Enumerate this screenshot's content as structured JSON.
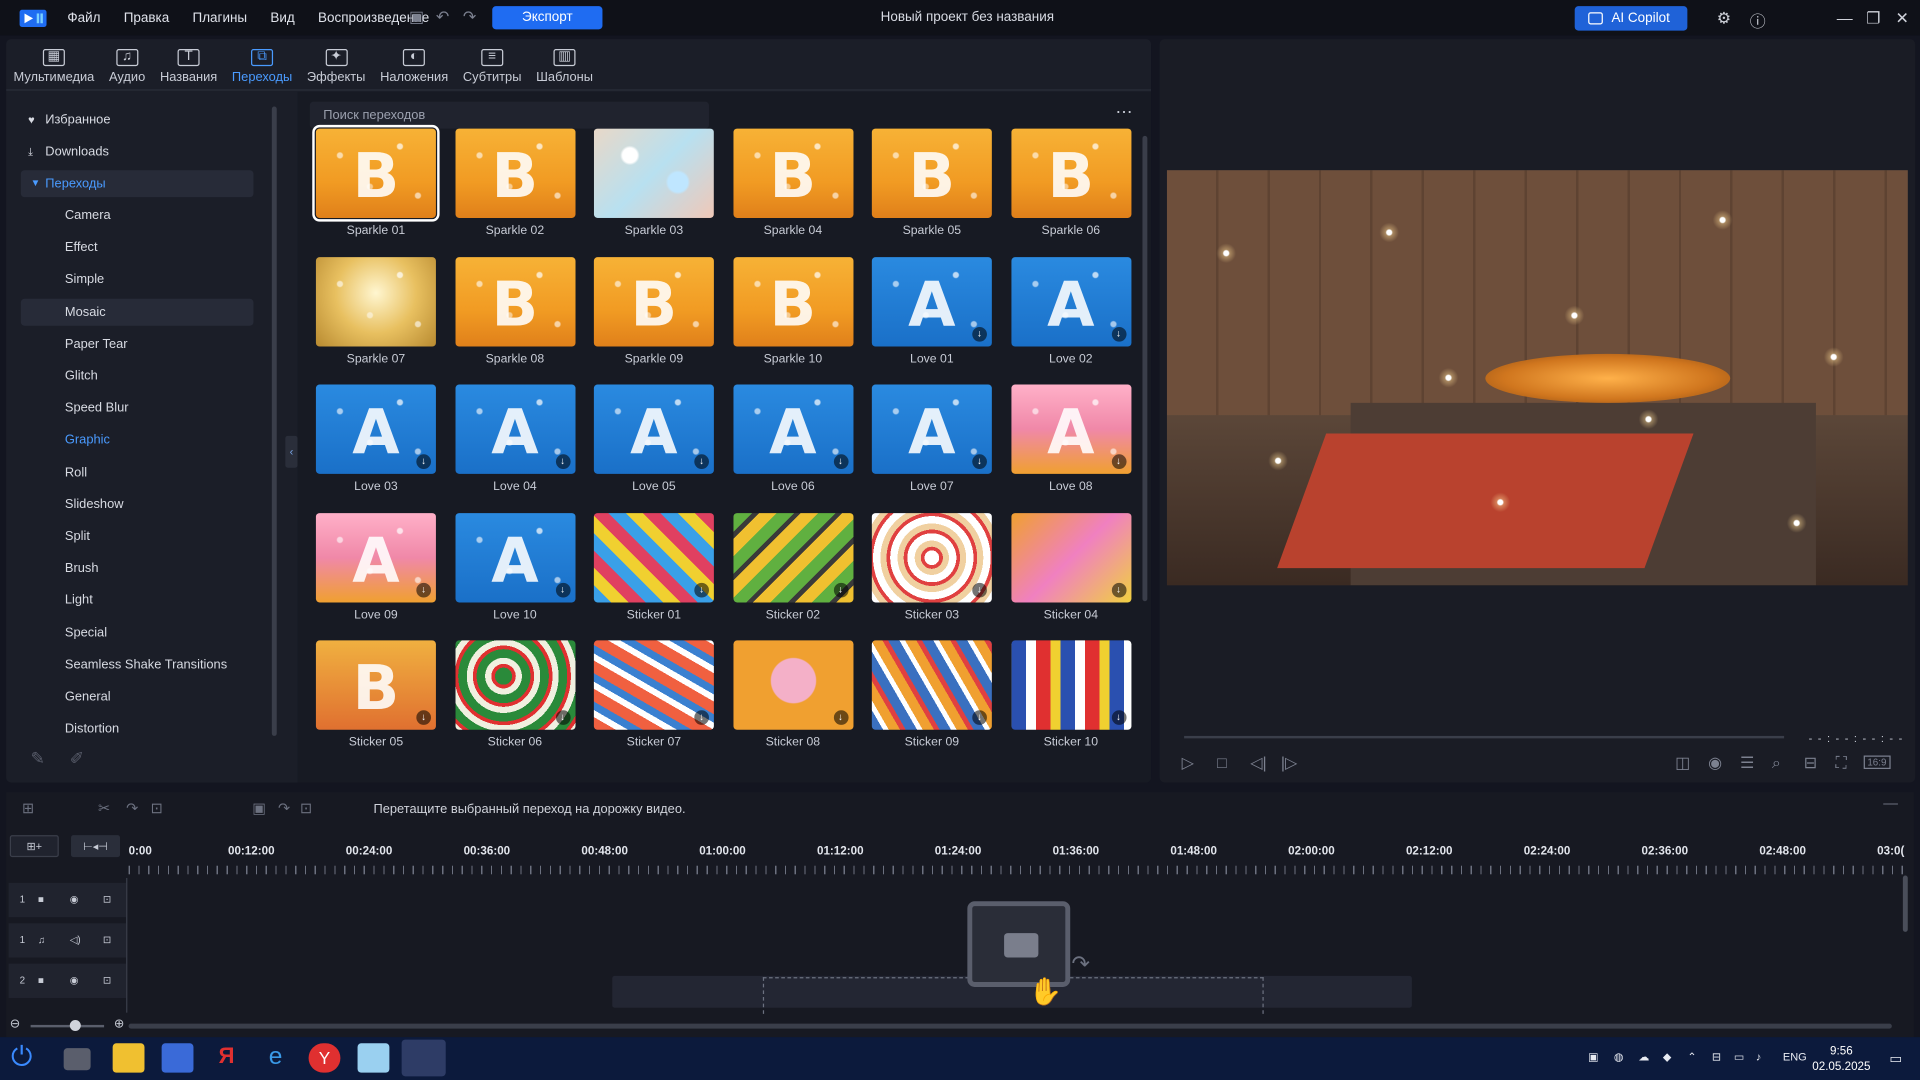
{
  "app": {
    "title": "Новый проект без названия",
    "menu": [
      "Файл",
      "Правка",
      "Плагины",
      "Вид",
      "Воспроизведение"
    ],
    "export_label": "Экспорт",
    "copilot_label": "AI Copilot",
    "accent": "#1f6cf2"
  },
  "tabs": [
    {
      "label": "Мультимедиа",
      "icon": "media-icon"
    },
    {
      "label": "Аудио",
      "icon": "music-note-icon"
    },
    {
      "label": "Названия",
      "icon": "text-t-icon"
    },
    {
      "label": "Переходы",
      "icon": "transition-icon",
      "active": true
    },
    {
      "label": "Эффекты",
      "icon": "effects-icon"
    },
    {
      "label": "Наложения",
      "icon": "overlay-icon"
    },
    {
      "label": "Субтитры",
      "icon": "subtitles-icon"
    },
    {
      "label": "Шаблоны",
      "icon": "templates-icon"
    }
  ],
  "sidebar": {
    "favorites": "Избранное",
    "downloads": "Downloads",
    "transitions": "Переходы",
    "categories": [
      "Camera",
      "Effect",
      "Simple",
      "Mosaic",
      "Paper Tear",
      "Glitch",
      "Speed Blur",
      "Graphic",
      "Roll",
      "Slideshow",
      "Split",
      "Brush",
      "Light",
      "Special",
      "Seamless Shake Transitions",
      "General",
      "Distortion"
    ]
  },
  "search": {
    "placeholder": "Поиск переходов"
  },
  "transitions": [
    {
      "name": "Sparkle 01",
      "kind": "sparkle",
      "glyph": "B"
    },
    {
      "name": "Sparkle 02",
      "kind": "sparkle",
      "glyph": "B"
    },
    {
      "name": "Sparkle 03",
      "kind": "bokeh",
      "glyph": ""
    },
    {
      "name": "Sparkle 04",
      "kind": "sparkle",
      "glyph": "B"
    },
    {
      "name": "Sparkle 05",
      "kind": "sparkle",
      "glyph": "B"
    },
    {
      "name": "Sparkle 06",
      "kind": "sparkle",
      "glyph": "B"
    },
    {
      "name": "Sparkle 07",
      "kind": "gold",
      "glyph": ""
    },
    {
      "name": "Sparkle 08",
      "kind": "sparkle",
      "glyph": "B"
    },
    {
      "name": "Sparkle 09",
      "kind": "sparkle",
      "glyph": "B"
    },
    {
      "name": "Sparkle 10",
      "kind": "sparkle",
      "glyph": "B"
    },
    {
      "name": "Love 01",
      "kind": "love",
      "glyph": "A",
      "dl": true
    },
    {
      "name": "Love 02",
      "kind": "love",
      "glyph": "A",
      "dl": true
    },
    {
      "name": "Love 03",
      "kind": "love",
      "glyph": "A",
      "dl": true
    },
    {
      "name": "Love 04",
      "kind": "love",
      "glyph": "A",
      "dl": true
    },
    {
      "name": "Love 05",
      "kind": "love",
      "glyph": "A",
      "dl": true
    },
    {
      "name": "Love 06",
      "kind": "love",
      "glyph": "A",
      "dl": true
    },
    {
      "name": "Love 07",
      "kind": "love",
      "glyph": "A",
      "dl": true
    },
    {
      "name": "Love 08",
      "kind": "hearts",
      "glyph": "A",
      "dl": true
    },
    {
      "name": "Love 09",
      "kind": "hearts",
      "glyph": "A",
      "dl": true
    },
    {
      "name": "Love 10",
      "kind": "love",
      "glyph": "A",
      "dl": true
    },
    {
      "name": "Sticker 01",
      "kind": "sticker-a",
      "glyph": "",
      "dl": true
    },
    {
      "name": "Sticker 02",
      "kind": "sticker-b",
      "glyph": "",
      "dl": true
    },
    {
      "name": "Sticker 03",
      "kind": "sticker-c",
      "glyph": "",
      "dl": true
    },
    {
      "name": "Sticker 04",
      "kind": "sticker-d",
      "glyph": "",
      "dl": true
    },
    {
      "name": "Sticker 05",
      "kind": "sticker-e",
      "glyph": "B",
      "dl": true
    },
    {
      "name": "Sticker 06",
      "kind": "sticker-f",
      "glyph": "",
      "dl": true
    },
    {
      "name": "Sticker 07",
      "kind": "sticker-g",
      "glyph": "",
      "dl": true
    },
    {
      "name": "Sticker 08",
      "kind": "sticker-h",
      "glyph": "",
      "dl": true
    },
    {
      "name": "Sticker 09",
      "kind": "sticker-i",
      "glyph": "",
      "dl": true
    },
    {
      "name": "Sticker 10",
      "kind": "sticker-j",
      "glyph": "",
      "dl": true
    }
  ],
  "preview": {
    "timecode": "- - : - - : - - : - -",
    "ratio": "16:9"
  },
  "timeline": {
    "hint": "Перетащите выбранный переход на дорожку видео.",
    "ruler": [
      "0:00",
      "00:12:00",
      "00:24:00",
      "00:36:00",
      "00:48:00",
      "01:00:00",
      "01:12:00",
      "01:24:00",
      "01:36:00",
      "01:48:00",
      "02:00:00",
      "02:12:00",
      "02:24:00",
      "02:36:00",
      "02:48:00",
      "03:0("
    ],
    "tracks": [
      {
        "num": "1",
        "type": "video"
      },
      {
        "num": "1",
        "type": "audio"
      },
      {
        "num": "2",
        "type": "video"
      }
    ]
  },
  "taskbar": {
    "lang": "ENG",
    "time": "9:56",
    "date": "02.05.2025"
  }
}
